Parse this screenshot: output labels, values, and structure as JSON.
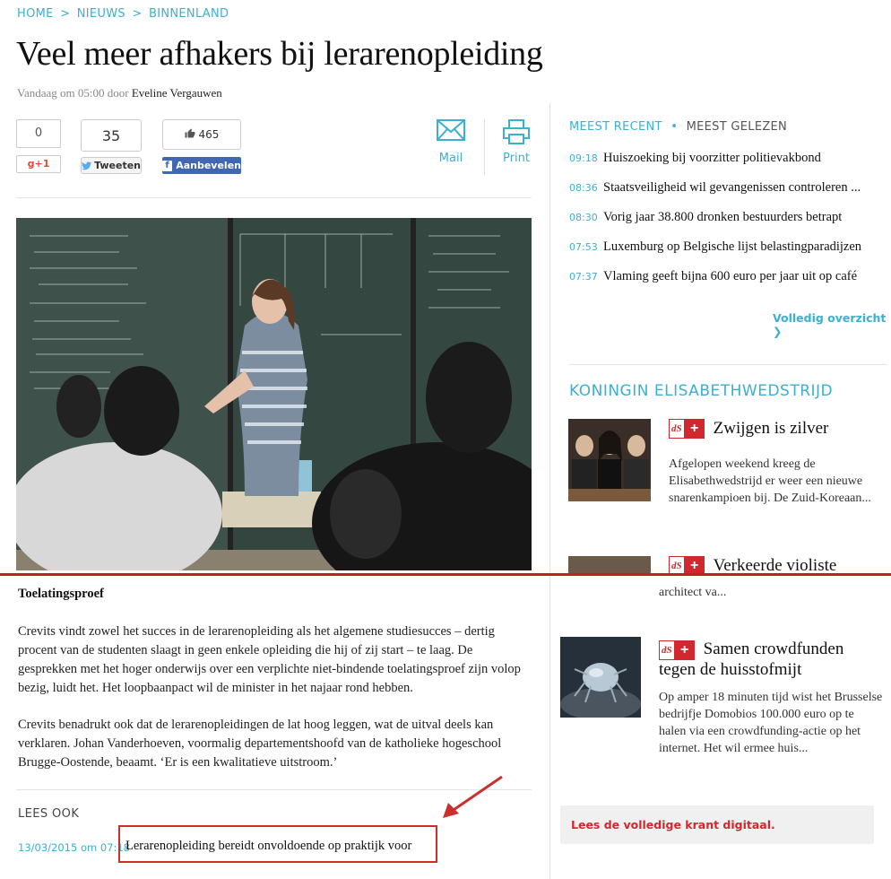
{
  "breadcrumb": {
    "home": "HOME",
    "nieuws": "NIEUWS",
    "binnenland": "BINNENLAND",
    "separator": ">"
  },
  "article": {
    "title": "Veel meer afhakers bij lerarenopleiding",
    "byline_prefix": "Vandaag om 05:00 door",
    "author": "Eveline Vergauwen",
    "subhead": "Toelatingsproef",
    "paragraphs": [
      "Crevits vindt zowel het succes in de lerarenopleiding als het algemene studiesucces – dertig procent van de studenten slaagt in geen enkele opleiding die hij of zij start – te laag. De gesprekken met het hoger onderwijs over een verplichte niet-bindende toelatingsproef zijn volop bezig, luidt het. Het loopbaanpact wil de minister in het najaar rond hebben.",
      "Crevits benadrukt ook dat de lerarenopleidingen de lat hoog leggen, wat de uitval deels kan verklaren. Johan Vanderhoeven, voormalig departementshoofd van de katholieke hogeschool Brugge-Oostende, beaamt. ‘Er is een kwalitatieve uitstroom.’"
    ]
  },
  "share": {
    "gplus_count": "0",
    "gplus_label": "g+1",
    "tweet_count": "35",
    "tweet_label": "Tweeten",
    "like_count": "465",
    "like_label": "Aanbevelen",
    "mail_label": "Mail",
    "print_label": "Print"
  },
  "sidebar": {
    "tab_recent": "MEEST RECENT",
    "tab_dot": "•",
    "tab_read": "MEEST GELEZEN",
    "recent": [
      {
        "time": "09:18",
        "title": "Huiszoeking bij voorzitter politievakbond"
      },
      {
        "time": "08:36",
        "title": "Staatsveiligheid wil gevangenissen controleren ..."
      },
      {
        "time": "08:30",
        "title": "Vorig jaar 38.800 dronken bestuurders betrapt"
      },
      {
        "time": "07:53",
        "title": "Luxemburg op Belgische lijst belastingparadijzen"
      },
      {
        "time": "07:37",
        "title": "Vlaming geeft bijna 600 euro per jaar uit op café"
      }
    ],
    "overview_link": "Volledig overzicht ❯",
    "section_title": "KONINGIN ELISABETHWEDSTRIJD",
    "badge_ds": "dS",
    "badge_plus": "+",
    "cards": [
      {
        "title": "Zwijgen is zilver",
        "text": "Afgelopen weekend kreeg de Elisabethwedstrijd er weer een nieuwe snarenkampioen bij. De Zuid-Koreaan..."
      },
      {
        "title": "Verkeerde violiste",
        "text": "architect va..."
      },
      {
        "title": "Samen crowdfunden tegen de huisstofmijt",
        "text": "Op amper 18 minuten tijd wist het Brusselse bedrijfje Domobios 100.000 euro op te halen via een crowdfunding-actie op het internet. Het wil ermee huis..."
      }
    ],
    "krant_link": "Lees de volledige krant digitaal."
  },
  "lees_ook": {
    "label": "LEES OOK",
    "date": "13/03/2015 om 07:18",
    "link": "Lerarenopleiding bereidt onvoldoende op praktijk voor"
  },
  "colors": {
    "accent": "#3bb0d0",
    "brand_red": "#d0282e",
    "facebook": "#4267b2",
    "annotation_red": "#c9302c"
  },
  "icons": [
    "mail-icon",
    "print-icon",
    "twitter-icon",
    "facebook-icon",
    "like-icon",
    "chevron-right-icon",
    "annotation-arrow"
  ]
}
